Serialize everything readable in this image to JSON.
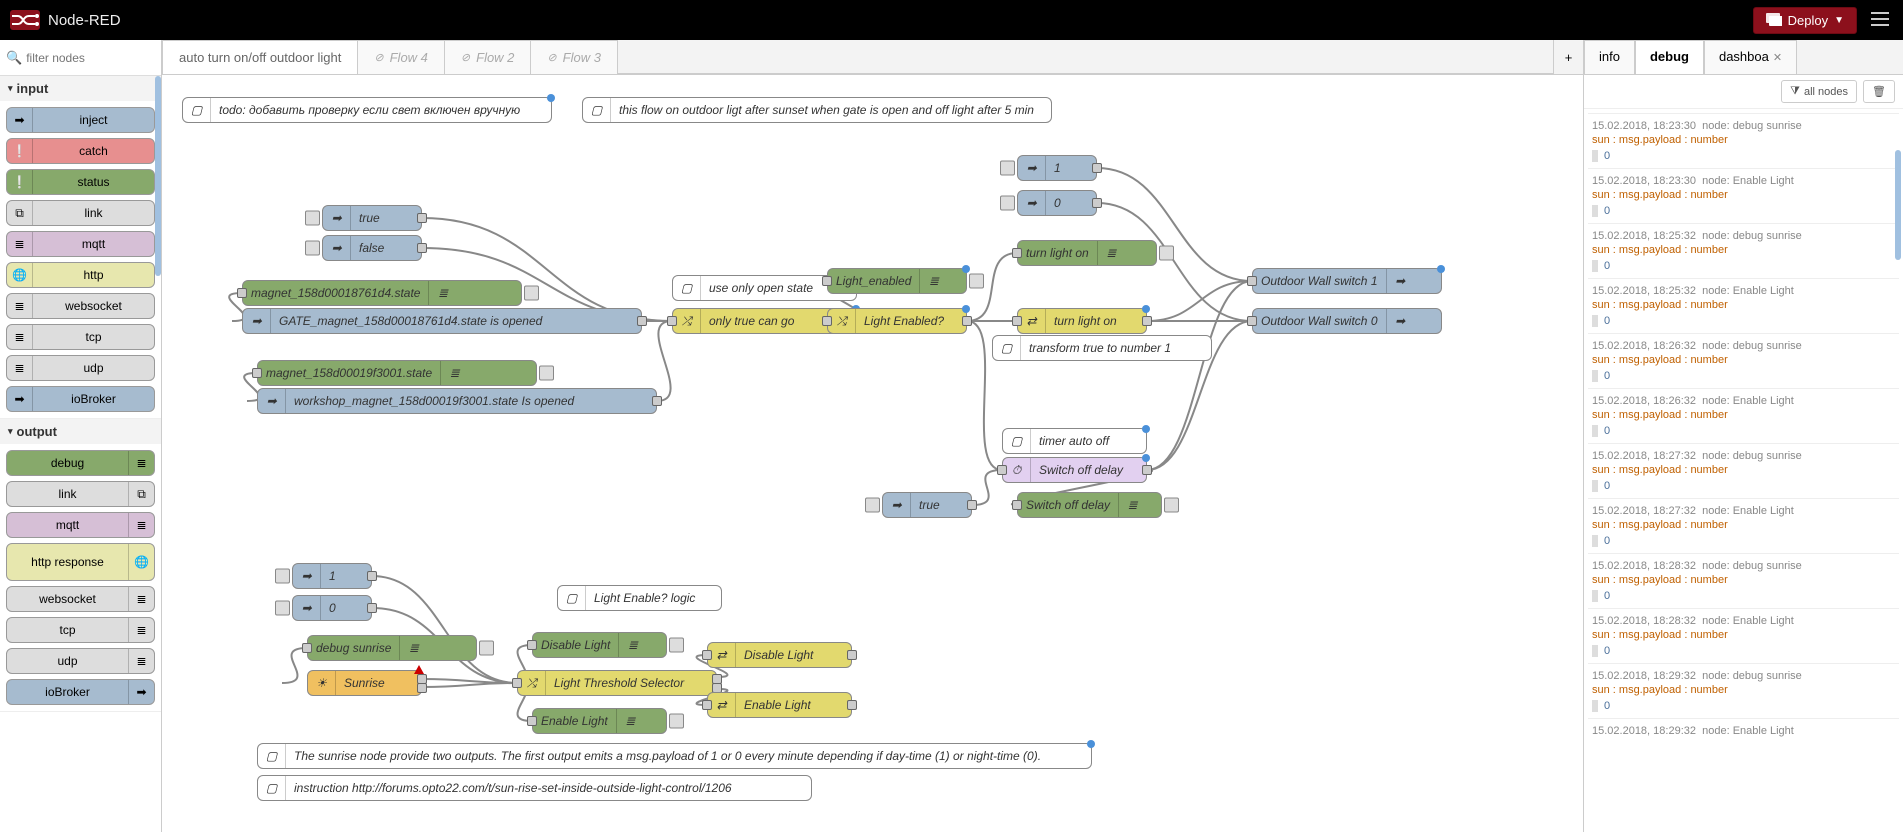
{
  "header": {
    "title": "Node-RED",
    "deploy": "Deploy"
  },
  "filter": {
    "placeholder": "filter nodes"
  },
  "palette": {
    "input": {
      "title": "input",
      "items": [
        {
          "label": "inject",
          "color": "c-blue",
          "icon": "arrow"
        },
        {
          "label": "catch",
          "color": "c-red",
          "icon": "excl"
        },
        {
          "label": "status",
          "color": "c-green",
          "icon": "excl"
        },
        {
          "label": "link",
          "color": "c-grey",
          "icon": "link"
        },
        {
          "label": "mqtt",
          "color": "c-purple",
          "icon": "bars"
        },
        {
          "label": "http",
          "color": "c-lyellow",
          "icon": "globe"
        },
        {
          "label": "websocket",
          "color": "c-grey",
          "icon": "bars"
        },
        {
          "label": "tcp",
          "color": "c-grey",
          "icon": "bars"
        },
        {
          "label": "udp",
          "color": "c-grey",
          "icon": "bars"
        },
        {
          "label": "ioBroker",
          "color": "c-blue",
          "icon": "arrow"
        }
      ]
    },
    "output": {
      "title": "output",
      "items": [
        {
          "label": "debug",
          "color": "c-green",
          "icon": "bars",
          "right": true
        },
        {
          "label": "link",
          "color": "c-grey",
          "icon": "link",
          "right": true
        },
        {
          "label": "mqtt",
          "color": "c-purple",
          "icon": "bars",
          "right": true
        },
        {
          "label": "http response",
          "color": "c-lyellow",
          "icon": "globe",
          "right": true,
          "tall": true
        },
        {
          "label": "websocket",
          "color": "c-grey",
          "icon": "bars",
          "right": true
        },
        {
          "label": "tcp",
          "color": "c-grey",
          "icon": "bars",
          "right": true
        },
        {
          "label": "udp",
          "color": "c-grey",
          "icon": "bars",
          "right": true
        },
        {
          "label": "ioBroker",
          "color": "c-blue",
          "icon": "arrow",
          "right": true
        }
      ]
    }
  },
  "tabs": [
    {
      "label": "auto turn on/off outdoor light",
      "disabled": false,
      "active": true
    },
    {
      "label": "Flow 4",
      "disabled": true
    },
    {
      "label": "Flow 2",
      "disabled": true
    },
    {
      "label": "Flow 3",
      "disabled": true
    }
  ],
  "sidebarTabs": {
    "info": "info",
    "debug": "debug",
    "dashboard": "dashboa"
  },
  "debugToolbar": {
    "allNodes": "all nodes"
  },
  "nodes": {
    "comment_todo": "todo: добавить проверку если свет включен вручную",
    "comment_desc": "this flow on outdoor ligt after sunset when gate is open and off light after 5 min",
    "true": "true",
    "false": "false",
    "one": "1",
    "zero": "0",
    "magnet1": "magnet_158d00018761d4.state",
    "gate": "GATE_magnet_158d00018761d4.state is opened",
    "magnet2": "magnet_158d00019f3001.state",
    "workshop": "workshop_magnet_158d00019f3001.state Is opened",
    "useOnly": "use only open state",
    "onlyTrue": "only true can go",
    "lightEnabled": "Light_enabled",
    "lightEnabledQ": "Light Enabled?",
    "turnLightOn_dbg": "turn light on",
    "turnLightOn": "turn light on",
    "transform": "transform true to number 1",
    "outdoor1": "Outdoor Wall switch 1",
    "outdoor0": "Outdoor Wall switch 0",
    "timerOff": "timer auto off",
    "switchOffDelay": "Switch off delay",
    "switchOffDelay2": "Switch off delay",
    "true2": "true",
    "one2": "1",
    "zero2": "0",
    "debugSunrise": "debug sunrise",
    "sunrise": "Sunrise",
    "lightEnableLogic": "Light Enable? logic",
    "disableLight": "Disable Light",
    "enableLight": "Enable Light",
    "lightThreshold": "Light Threshold Selector",
    "disableLight2": "Disable Light",
    "enableLight2": "Enable Light",
    "sunriseDesc": "The sunrise node provide two outputs. The first output emits a msg.payload of 1 or 0 every minute depending if day-time (1) or night-time (0).",
    "instruction": "instruction http://forums.opto22.com/t/sun-rise-set-inside-outside-light-control/1206"
  },
  "debugMsgs": [
    {
      "ts": "15.02.2018, 18:23:30",
      "node": "debug sunrise",
      "path": "sun : msg.payload : number",
      "val": "0"
    },
    {
      "ts": "15.02.2018, 18:23:30",
      "node": "Enable Light",
      "path": "sun : msg.payload : number",
      "val": "0"
    },
    {
      "ts": "15.02.2018, 18:25:32",
      "node": "debug sunrise",
      "path": "sun : msg.payload : number",
      "val": "0"
    },
    {
      "ts": "15.02.2018, 18:25:32",
      "node": "Enable Light",
      "path": "sun : msg.payload : number",
      "val": "0"
    },
    {
      "ts": "15.02.2018, 18:26:32",
      "node": "debug sunrise",
      "path": "sun : msg.payload : number",
      "val": "0"
    },
    {
      "ts": "15.02.2018, 18:26:32",
      "node": "Enable Light",
      "path": "sun : msg.payload : number",
      "val": "0"
    },
    {
      "ts": "15.02.2018, 18:27:32",
      "node": "debug sunrise",
      "path": "sun : msg.payload : number",
      "val": "0"
    },
    {
      "ts": "15.02.2018, 18:27:32",
      "node": "Enable Light",
      "path": "sun : msg.payload : number",
      "val": "0"
    },
    {
      "ts": "15.02.2018, 18:28:32",
      "node": "debug sunrise",
      "path": "sun : msg.payload : number",
      "val": "0"
    },
    {
      "ts": "15.02.2018, 18:28:32",
      "node": "Enable Light",
      "path": "sun : msg.payload : number",
      "val": "0"
    },
    {
      "ts": "15.02.2018, 18:29:32",
      "node": "debug sunrise",
      "path": "sun : msg.payload : number",
      "val": "0"
    },
    {
      "ts": "15.02.2018, 18:29:32",
      "node": "Enable Light",
      "path": "",
      "val": ""
    }
  ]
}
